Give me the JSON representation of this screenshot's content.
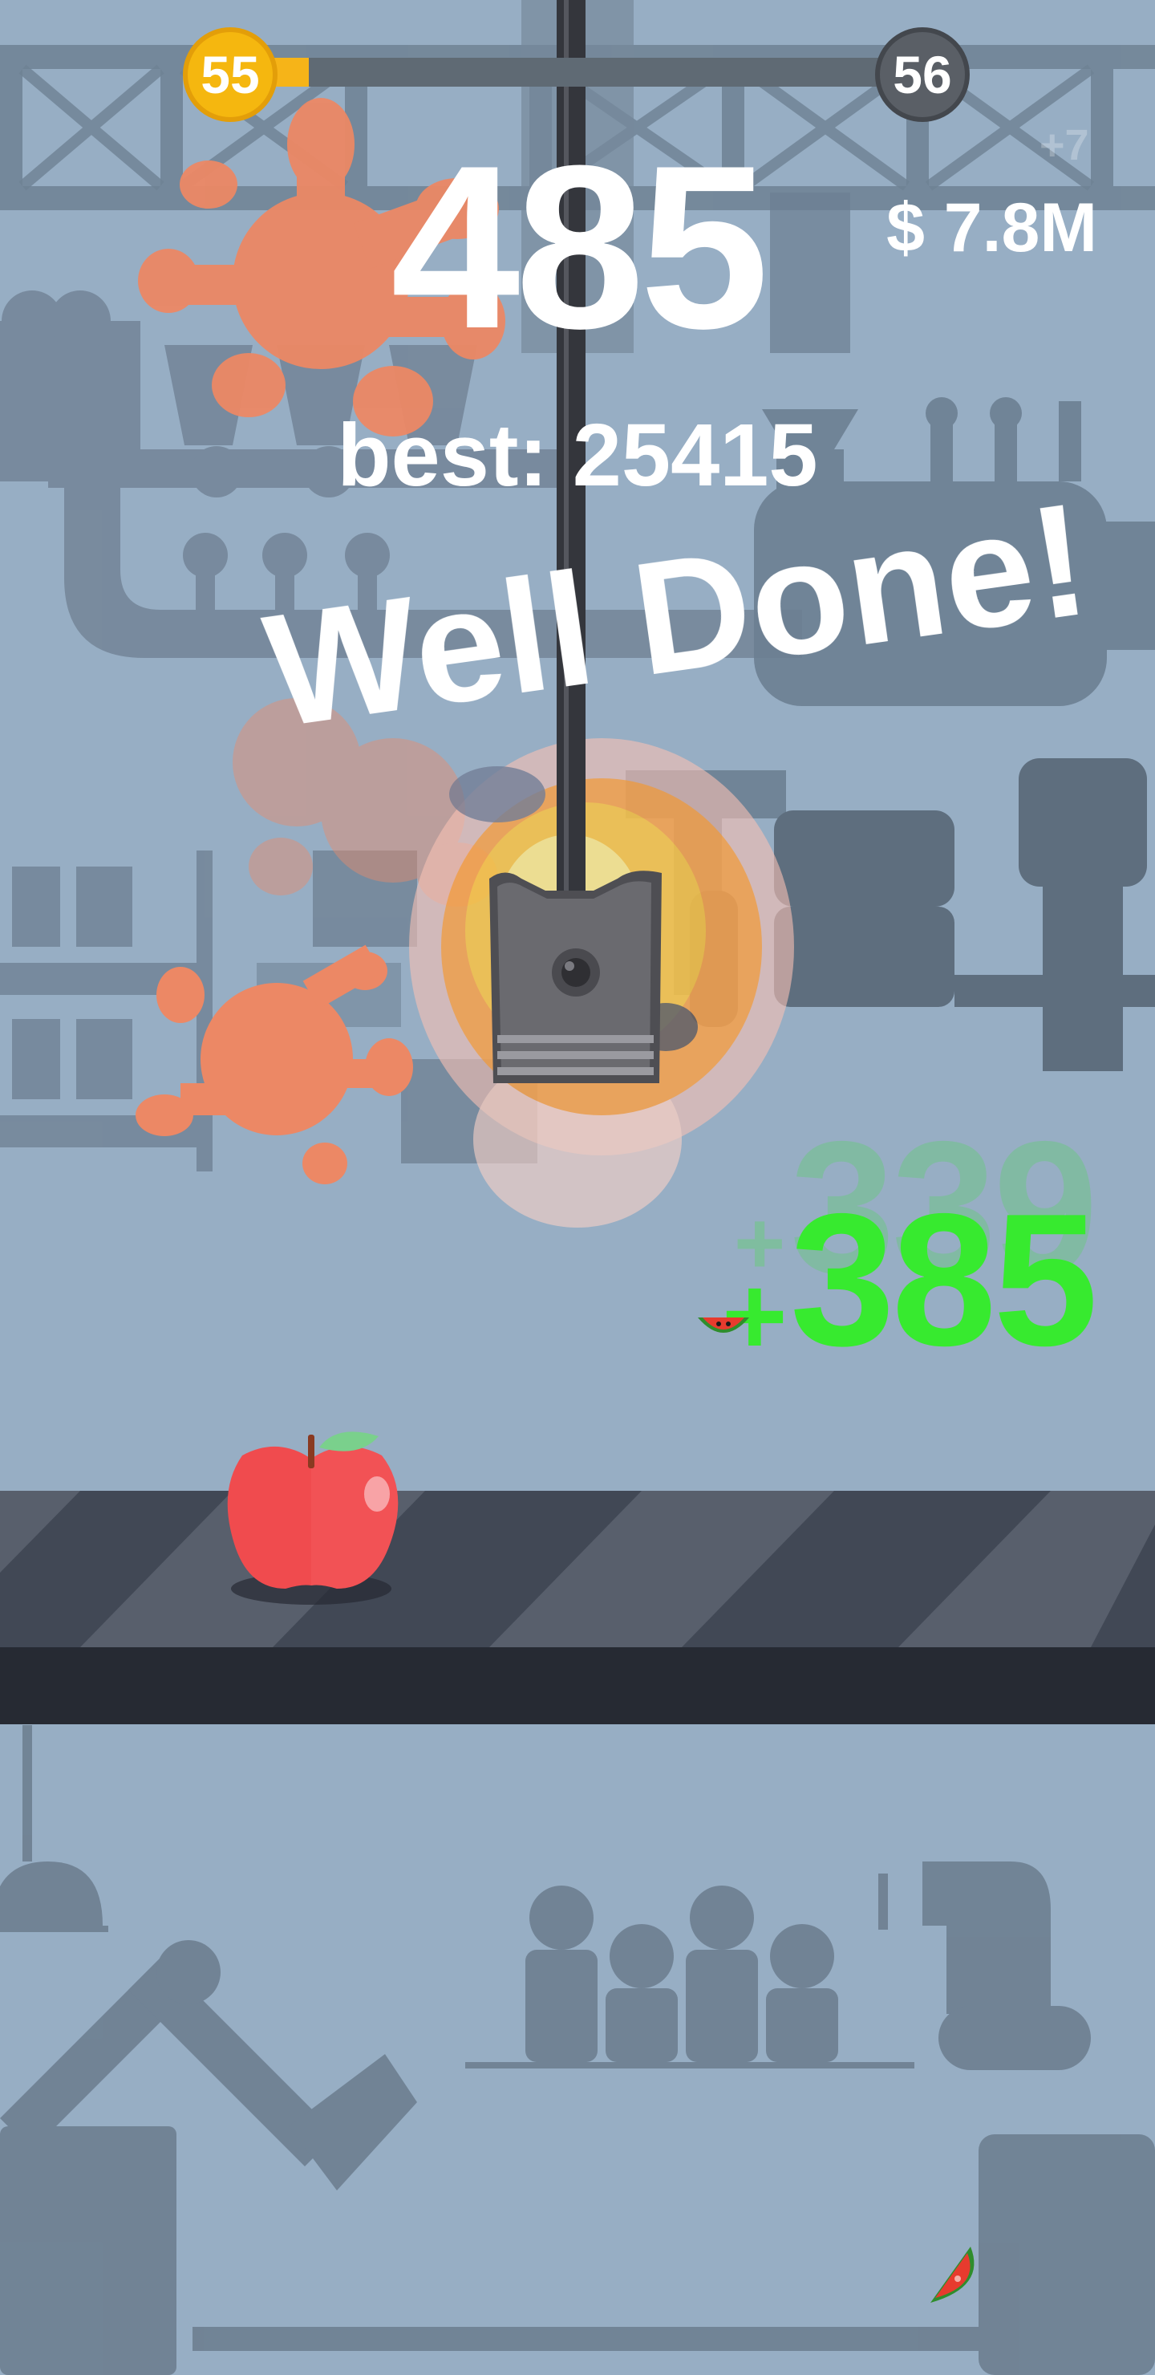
{
  "level": {
    "current": "55",
    "next": "56",
    "progress_fraction": 0.07,
    "colors": {
      "current": "#f5b70f",
      "next": "#5a5f66",
      "fill": "#f6b418",
      "track": "#5f6a74"
    }
  },
  "score": {
    "value": "485",
    "best_label": "best: 25415"
  },
  "money": {
    "value": "$ 7.8M",
    "increment": "+7"
  },
  "message": {
    "text": "Well Done!"
  },
  "gain": {
    "value": "385",
    "plus": "+",
    "ghost_value": "339",
    "color": "#37ea2f"
  },
  "icons": {
    "fruit": "apple-icon",
    "press": "piston-press-icon",
    "splash": "juice-splash-icon",
    "conveyor": "conveyor-belt-icon",
    "small_fruit": "watermelon-slice-icon"
  }
}
